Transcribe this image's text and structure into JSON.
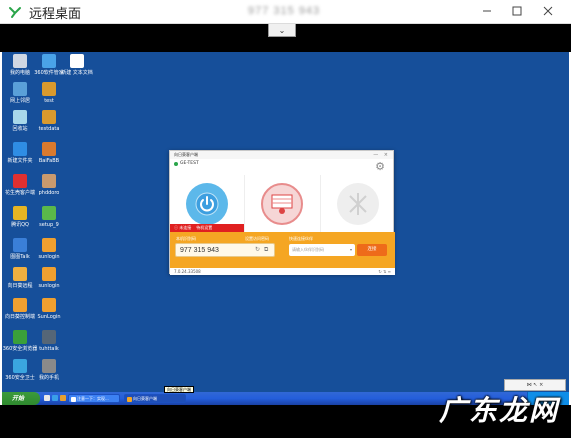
{
  "remote_window": {
    "title": "远程桌面",
    "host": "977 315 943"
  },
  "desktop_icons": [
    {
      "label": "我的电脑",
      "color": "#cfd7e3"
    },
    {
      "label": "360软件管家",
      "color": "#4aa3e8"
    },
    {
      "label": "新建 文本文档",
      "color": "#ffffff"
    },
    {
      "label": "网上邻居",
      "color": "#5aa0d8"
    },
    {
      "label": "test",
      "color": "#d99a2e"
    },
    {
      "label": "回收站",
      "color": "#a8d8ea"
    },
    {
      "label": "testdata",
      "color": "#d99a2e"
    },
    {
      "label": "新建文件夹",
      "color": "#2f8de4"
    },
    {
      "label": "BaiFaBB",
      "color": "#d97a2e"
    },
    {
      "label": "花生壳客户端",
      "color": "#e03030"
    },
    {
      "label": "phddoro",
      "color": "#c99a6e"
    },
    {
      "label": "腾讯QQ",
      "color": "#e6b422"
    },
    {
      "label": "setup_9",
      "color": "#5ab84a"
    },
    {
      "label": "图图Talk",
      "color": "#3a7fd8"
    },
    {
      "label": "sunlogin",
      "color": "#f0a030"
    },
    {
      "label": "向日葵远程",
      "color": "#f0b040"
    },
    {
      "label": "sunlogin",
      "color": "#f0a030"
    },
    {
      "label": "向日葵控制端",
      "color": "#f0a030"
    },
    {
      "label": "SunLogin",
      "color": "#f0a030"
    },
    {
      "label": "360安全浏览器",
      "color": "#3aa03a"
    },
    {
      "label": "tuhttalk",
      "color": "#556677"
    },
    {
      "label": "360安全卫士",
      "color": "#3aa6e0"
    },
    {
      "label": "我的手机",
      "color": "#8a8a8a"
    }
  ],
  "sunlogin": {
    "titlebar": "向日葵客户端",
    "window_controls": "— ×",
    "device_name": "GE-TEST",
    "alert_left": "ⓘ 未连接",
    "alert_right": "待机设置",
    "id_label": "本机识别码",
    "verify_label": "设置访问密码",
    "remote_label": "快速连接伙伴",
    "code": "977 315 943",
    "refresh_icon": "↻",
    "copy_icon": "⧉",
    "input_placeholder": "请输入伙伴识别码",
    "input_caret": "▾",
    "connect_label": "连接",
    "version": "7.0.24.33508",
    "footer_right": "↻ ⇅ ≡"
  },
  "taskbar": {
    "start_label": "开始",
    "buttons": [
      "注意一下：实现...",
      "向日葵客户端"
    ],
    "tooltip": "向日葵客户端"
  },
  "floatbar": {
    "icons": "⋈ ↖ ×"
  },
  "watermark": "广东龙网",
  "drop_tab": "⌄"
}
